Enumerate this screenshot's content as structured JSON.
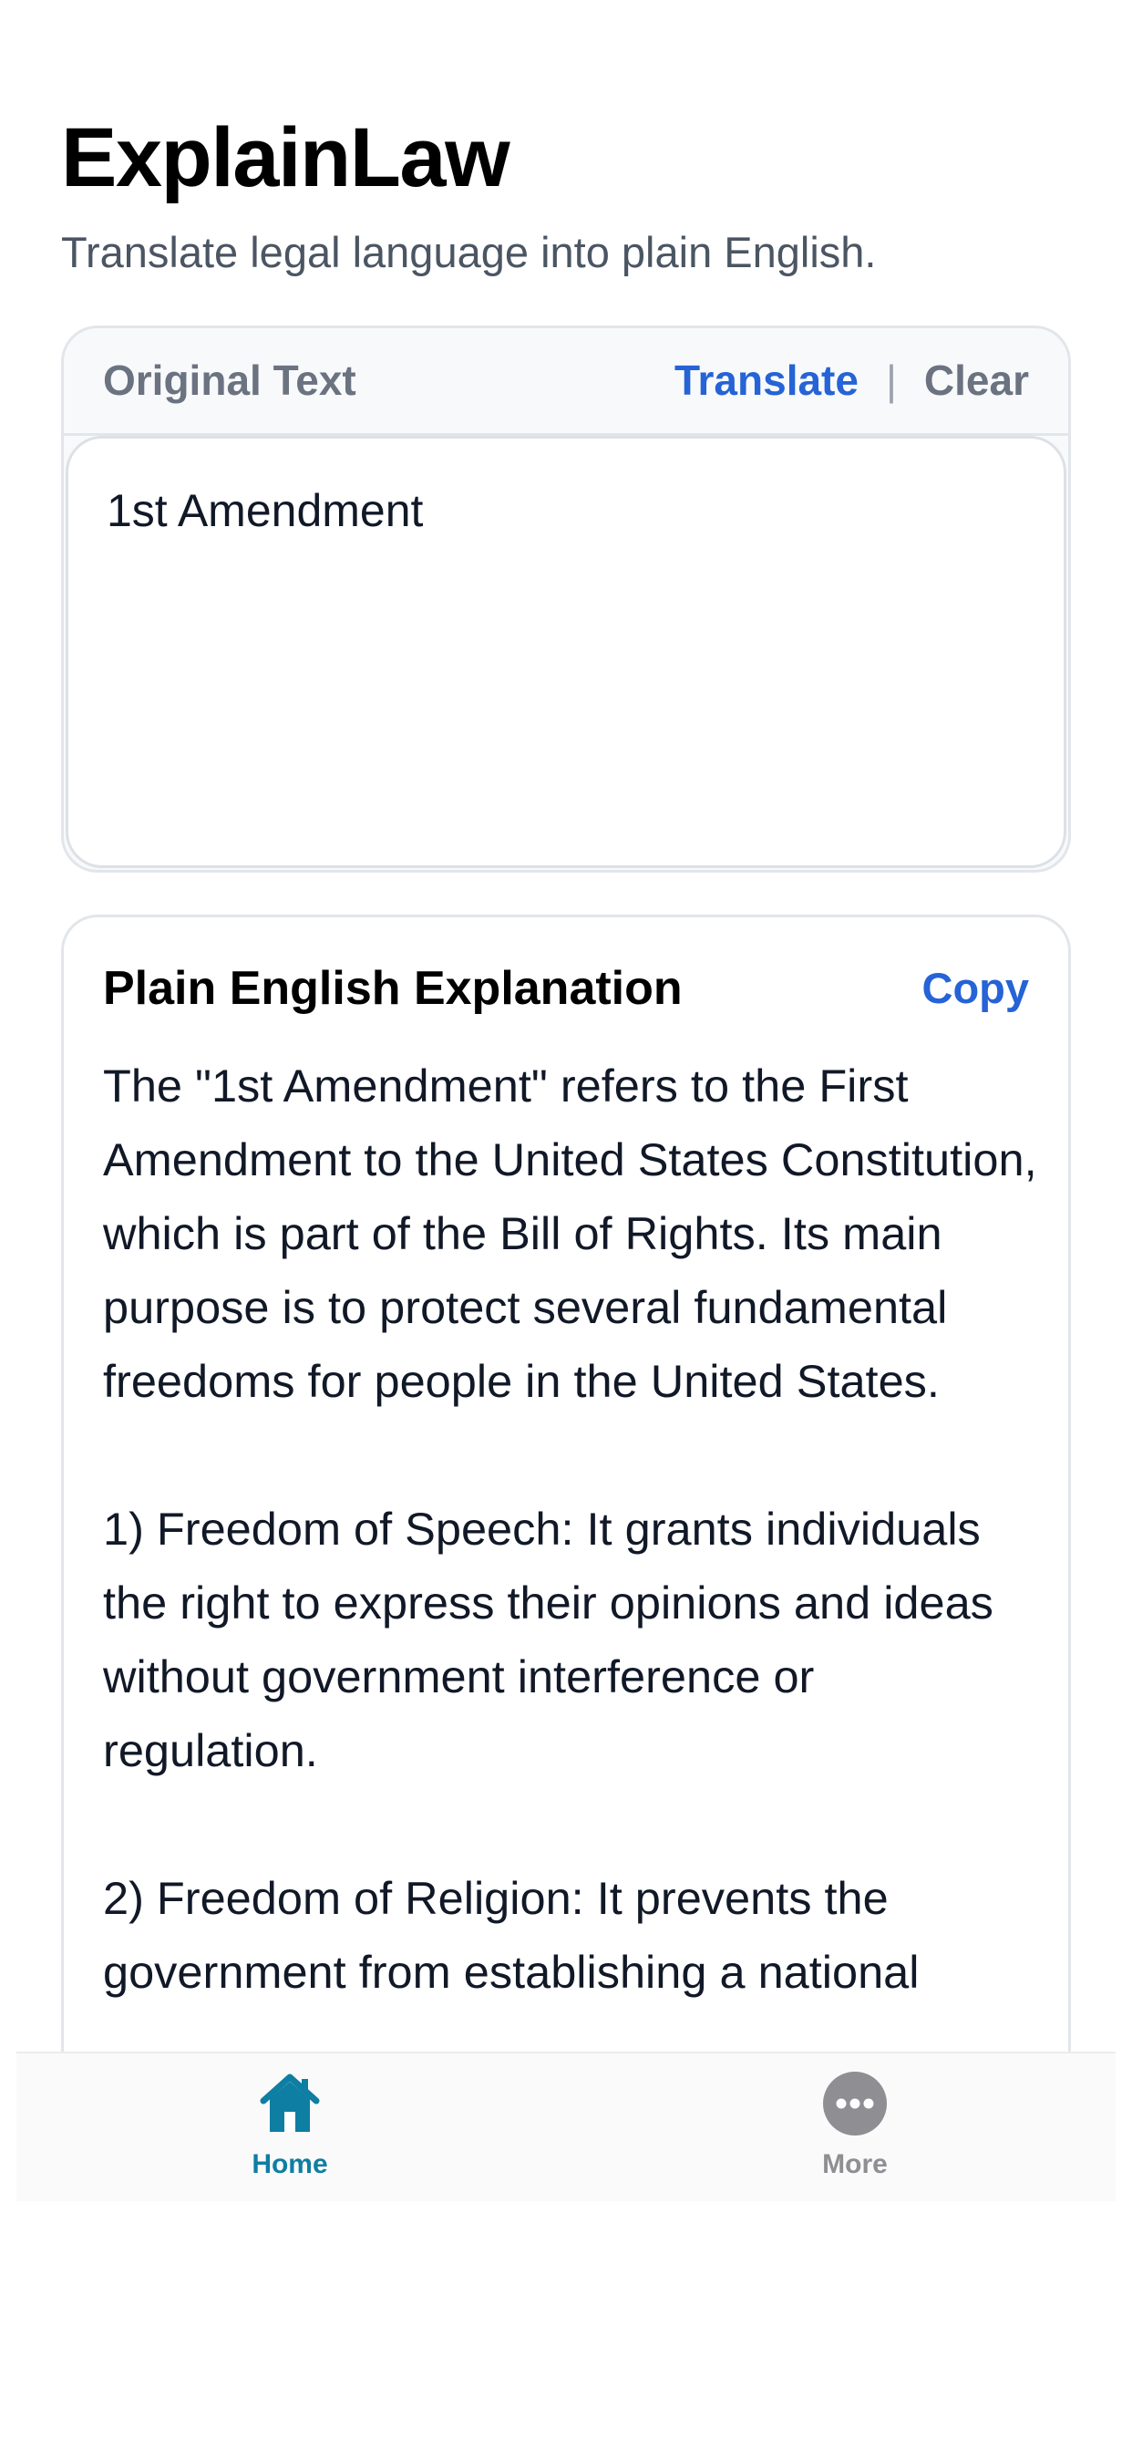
{
  "header": {
    "title": "ExplainLaw",
    "subtitle": "Translate legal language into plain English."
  },
  "input_card": {
    "label": "Original Text",
    "translate_label": "Translate",
    "divider": "|",
    "clear_label": "Clear",
    "value": "1st Amendment"
  },
  "output_card": {
    "title": "Plain English Explanation",
    "copy_label": "Copy",
    "paragraphs": [
      "The \"1st Amendment\" refers to the First Amendment to the United States Constitution, which is part of the Bill of Rights. Its main purpose is to protect several fundamental freedoms for people in the United States.",
      "1) Freedom of Speech: It grants individuals the right to express their opinions and ideas without government interference or regulation.",
      "2) Freedom of Religion: It prevents the government from establishing a national"
    ]
  },
  "tab_bar": {
    "tabs": [
      {
        "label": "Home",
        "icon": "home-icon",
        "active": true
      },
      {
        "label": "More",
        "icon": "more-icon",
        "active": false
      }
    ]
  },
  "colors": {
    "accent": "#2563d6",
    "tab_active": "#0e7ea3",
    "tab_inactive": "#8e8e93"
  }
}
